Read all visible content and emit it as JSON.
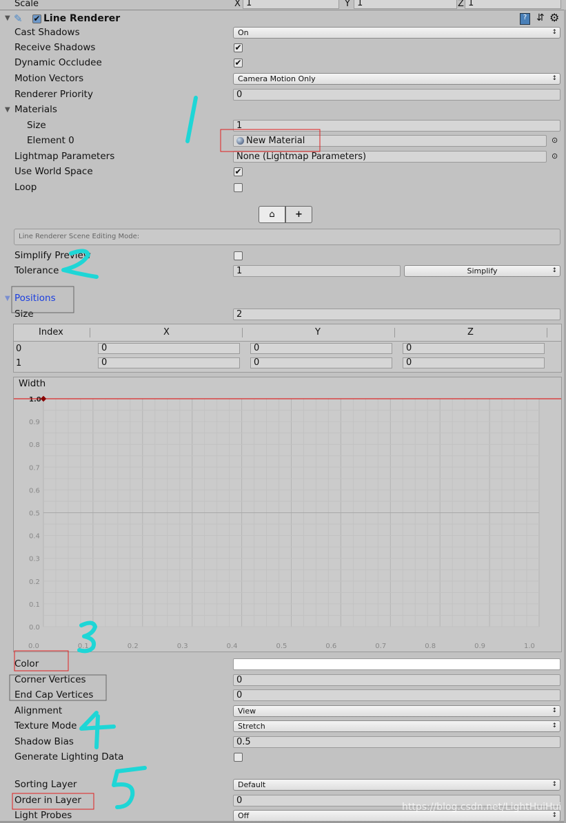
{
  "top_row": {
    "label": "Scale",
    "x": "X",
    "y": "Y",
    "z": "Z",
    "x_value": "1",
    "y_value": "1",
    "z_value": "1"
  },
  "component": {
    "title": "Line Renderer",
    "enabled": true,
    "icons": [
      "help-book-icon",
      "preset-sliders-icon",
      "gear-icon"
    ]
  },
  "fields": {
    "cast_shadows": {
      "label": "Cast Shadows",
      "value": "On"
    },
    "receive_shadows": {
      "label": "Receive Shadows",
      "checked": true
    },
    "dynamic_occludee": {
      "label": "Dynamic Occludee",
      "checked": true
    },
    "motion_vectors": {
      "label": "Motion Vectors",
      "value": "Camera Motion Only"
    },
    "renderer_priority": {
      "label": "Renderer Priority",
      "value": "0"
    },
    "materials": {
      "label": "Materials",
      "size_label": "Size",
      "size": "1",
      "element_label": "Element 0",
      "element_value": "New Material"
    },
    "lightmap": {
      "label": "Lightmap Parameters",
      "value": "None (Lightmap Parameters)"
    },
    "use_world_space": {
      "label": "Use World Space",
      "checked": true
    },
    "loop": {
      "label": "Loop",
      "checked": false
    },
    "editing_mode": {
      "label": "Line Renderer Scene Editing Mode:",
      "edit_points_symbol": "⌂",
      "add_symbol": "+"
    },
    "simplify_preview": {
      "label": "Simplify Preview",
      "checked": false
    },
    "tolerance": {
      "label": "Tolerance",
      "value": "1",
      "button": "Simplify"
    },
    "positions": {
      "label": "Positions",
      "size_label": "Size",
      "size": "2",
      "headers": [
        "Index",
        "X",
        "Y",
        "Z"
      ],
      "rows": [
        [
          "0",
          "0",
          "0",
          "0"
        ],
        [
          "1",
          "0",
          "0",
          "0"
        ]
      ]
    },
    "color": {
      "label": "Color",
      "value": "#ffffff"
    },
    "corner_vertices": {
      "label": "Corner Vertices",
      "value": "0"
    },
    "end_cap_vertices": {
      "label": "End Cap Vertices",
      "value": "0"
    },
    "alignment": {
      "label": "Alignment",
      "value": "View"
    },
    "texture_mode": {
      "label": "Texture Mode",
      "value": "Stretch"
    },
    "shadow_bias": {
      "label": "Shadow Bias",
      "value": "0.5"
    },
    "generate_lighting": {
      "label": "Generate Lighting Data",
      "checked": false
    },
    "sorting_layer": {
      "label": "Sorting Layer",
      "value": "Default"
    },
    "order_in_layer": {
      "label": "Order in Layer",
      "value": "0"
    },
    "light_probes": {
      "label": "Light Probes",
      "value": "Off"
    }
  },
  "width_curve": {
    "label": "Width",
    "y_ticks": [
      "1.0",
      "0.9",
      "0.8",
      "0.7",
      "0.6",
      "0.5",
      "0.4",
      "0.3",
      "0.2",
      "0.1",
      "0.0"
    ],
    "x_ticks": [
      "0.0",
      "0.1",
      "0.2",
      "0.3",
      "0.4",
      "0.5",
      "0.6",
      "0.7",
      "0.8",
      "0.9",
      "1.0"
    ],
    "keys": [
      [
        0,
        1.0
      ]
    ],
    "value": 1.0,
    "curve_color": "#e00000"
  },
  "annotations": {
    "numbers": [
      "1",
      "2",
      "3",
      "4",
      "5"
    ],
    "color": "#1ed6d6",
    "box_color": "#e02020"
  },
  "watermark": "https://blog.csdn.net/LightHuiHui"
}
